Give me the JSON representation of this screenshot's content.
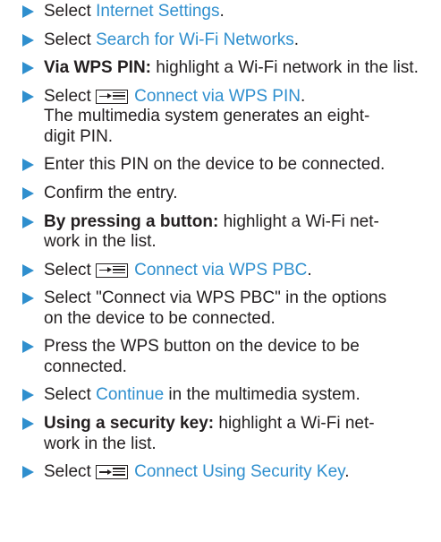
{
  "colors": {
    "accent": "#2f8fce",
    "text": "#231f20"
  },
  "steps": [
    {
      "prefix": "Select ",
      "link": "Internet Settings",
      "suffix": "."
    },
    {
      "prefix": "Select ",
      "link": "Search for Wi-Fi Networks",
      "suffix": "."
    },
    {
      "bold": "Via WPS PIN:",
      "text": " highlight a Wi-Fi network in the list."
    },
    {
      "prefix": "Select ",
      "icon": "menu-options-icon",
      "link": "Connect via WPS PIN",
      "suffix": ".",
      "line1": "The multimedia system generates an eight-",
      "line2": "digit PIN."
    },
    {
      "text": "Enter this PIN on the device to be connected."
    },
    {
      "text": "Confirm the entry."
    },
    {
      "bold": "By pressing a button:",
      "line1": " highlight a Wi-Fi net-",
      "line2": "work in the list."
    },
    {
      "prefix": "Select ",
      "icon": "menu-options-icon",
      "link": "Connect via WPS PBC",
      "suffix": "."
    },
    {
      "line1": "Select \"Connect via WPS PBC\" in the options",
      "line2": "on the device to be connected."
    },
    {
      "line1": "Press the WPS button on the device to be",
      "line2": "connected."
    },
    {
      "prefix": "Select ",
      "link": "Continue",
      "suffix": " in the multimedia system."
    },
    {
      "bold": "Using a security key:",
      "line1": " highlight a Wi-Fi net-",
      "line2": "work in the list."
    },
    {
      "prefix": "Select ",
      "icon": "menu-options-icon",
      "link": "Connect Using Security Key",
      "suffix": "."
    }
  ]
}
